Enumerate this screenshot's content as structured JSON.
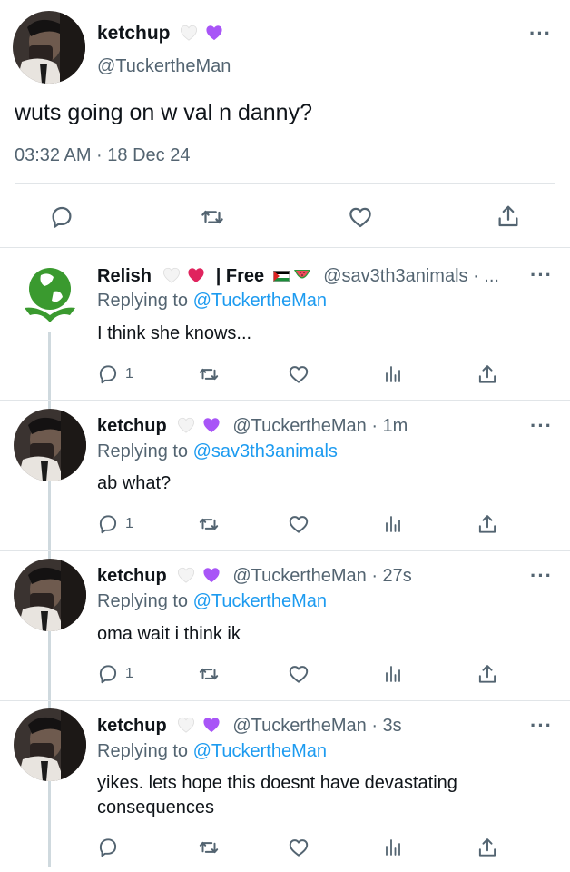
{
  "main_tweet": {
    "name": "ketchup",
    "handle": "@TuckertheMan",
    "text": "wuts going on w val n danny?",
    "timestamp": "03:32 AM · 18 Dec 24",
    "more": "···"
  },
  "replies": [
    {
      "name": "Relish",
      "name_suffix": "| Free",
      "handle_time": "@sav3th3animals · ...",
      "replying_prefix": "Replying to",
      "replying_to": "@TuckertheMan",
      "text": "I think she knows...",
      "reply_count": "1",
      "more": "···"
    },
    {
      "name": "ketchup",
      "handle_time": "@TuckertheMan · 1m",
      "replying_prefix": "Replying to",
      "replying_to": "@sav3th3animals",
      "text": "ab what?",
      "reply_count": "1",
      "more": "···"
    },
    {
      "name": "ketchup",
      "handle_time": "@TuckertheMan · 27s",
      "replying_prefix": "Replying to",
      "replying_to": "@TuckertheMan",
      "text": "oma wait i think ik",
      "reply_count": "1",
      "more": "···"
    },
    {
      "name": "ketchup",
      "handle_time": "@TuckertheMan · 3s",
      "replying_prefix": "Replying to",
      "replying_to": "@TuckertheMan",
      "text": "yikes. lets hope this doesnt have devastating consequences",
      "reply_count": "",
      "more": "···"
    }
  ],
  "colors": {
    "link": "#1d9bf0",
    "secondary_text": "#536471",
    "divider": "#e1e5e8",
    "purple_heart": "#a855f7",
    "red_heart": "#e0245e",
    "relish_green": "#3a9a2f"
  },
  "icons": {
    "reply": "reply-icon",
    "retweet": "retweet-icon",
    "like": "like-icon",
    "analytics": "analytics-icon",
    "share": "share-icon"
  }
}
